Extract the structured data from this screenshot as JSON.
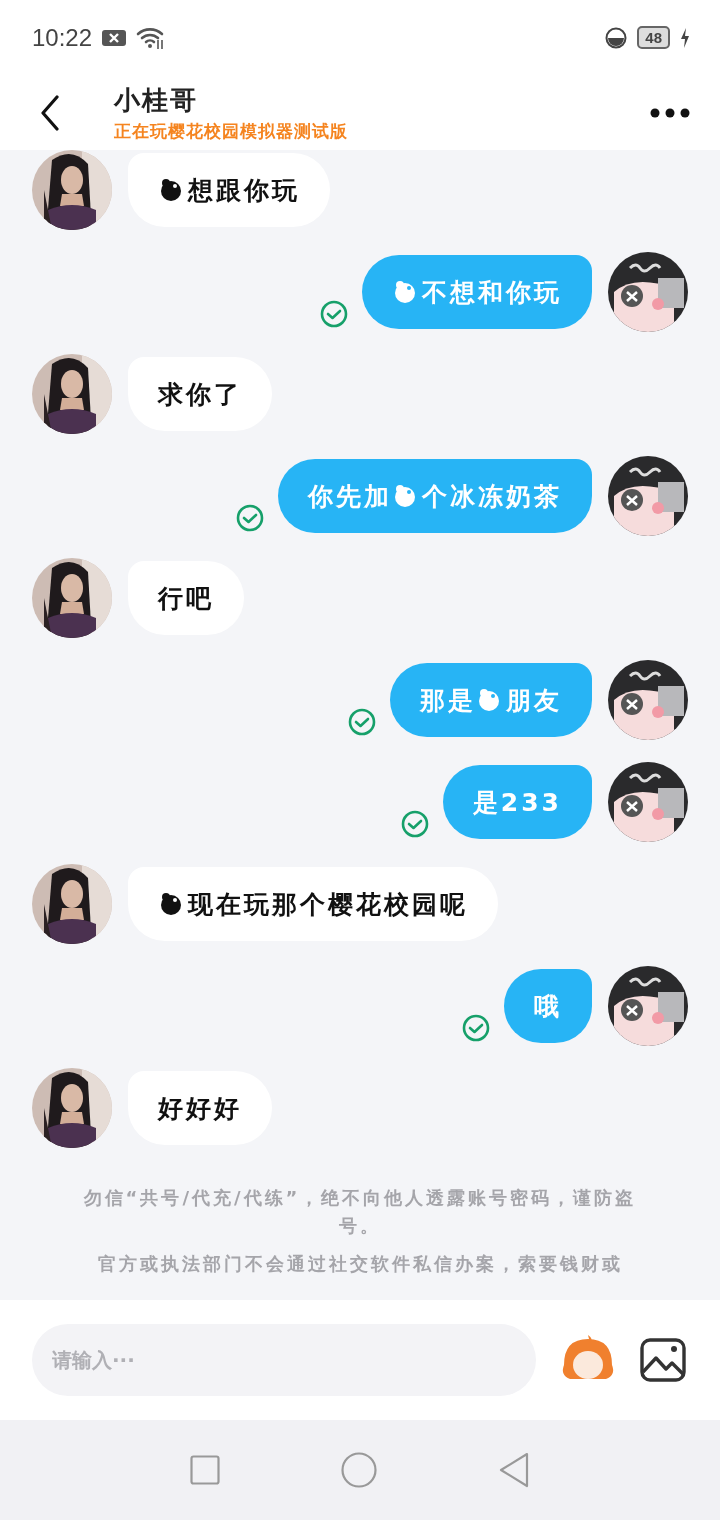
{
  "status_bar": {
    "time": "10:22",
    "battery": "48"
  },
  "header": {
    "title": "小桂哥",
    "subtitle": "正在玩樱花校园模拟器测试版"
  },
  "messages": [
    {
      "kind": "received",
      "parts": [
        {
          "kind": "icon"
        },
        {
          "kind": "text",
          "text": "想跟你玩"
        }
      ]
    },
    {
      "kind": "sent",
      "read": true,
      "parts": [
        {
          "kind": "icon"
        },
        {
          "kind": "text",
          "text": "不想和你玩"
        }
      ]
    },
    {
      "kind": "received",
      "parts": [
        {
          "kind": "text",
          "text": "求你了"
        }
      ]
    },
    {
      "kind": "sent",
      "read": true,
      "parts": [
        {
          "kind": "text",
          "text": "你先加"
        },
        {
          "kind": "icon"
        },
        {
          "kind": "text",
          "text": "个冰冻奶茶"
        }
      ]
    },
    {
      "kind": "received",
      "parts": [
        {
          "kind": "text",
          "text": "行吧"
        }
      ]
    },
    {
      "kind": "sent",
      "read": true,
      "parts": [
        {
          "kind": "text",
          "text": "那是"
        },
        {
          "kind": "icon"
        },
        {
          "kind": "text",
          "text": "朋友"
        }
      ]
    },
    {
      "kind": "sent",
      "read": true,
      "parts": [
        {
          "kind": "text",
          "text": "是233"
        }
      ]
    },
    {
      "kind": "received",
      "parts": [
        {
          "kind": "icon"
        },
        {
          "kind": "text",
          "text": "现在玩那个樱花校园呢"
        }
      ]
    },
    {
      "kind": "sent",
      "read": true,
      "parts": [
        {
          "kind": "text",
          "text": "哦"
        }
      ]
    },
    {
      "kind": "received",
      "parts": [
        {
          "kind": "text",
          "text": "好好好"
        }
      ]
    }
  ],
  "notice": [
    "勿信“共号/代充/代练”，绝不向他人透露账号密码，谨防盗号。",
    "官方或执法部门不会通过社交软件私信办案，索要钱财或"
  ],
  "input": {
    "placeholder": "请输入···"
  }
}
